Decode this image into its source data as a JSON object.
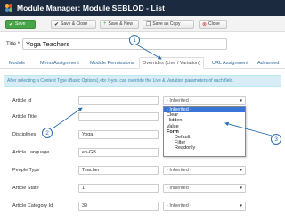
{
  "header": {
    "title": "Module Manager: Module SEBLOD - List"
  },
  "toolbar": {
    "save": "Save",
    "save_close": "Save & Close",
    "save_new": "Save & New",
    "save_copy": "Save as Copy",
    "close": "Close"
  },
  "title_field": {
    "label": "Title *",
    "value": "Yoga Teachers"
  },
  "tabs": [
    {
      "label": "Module"
    },
    {
      "label": "Menu Assignment"
    },
    {
      "label": "Module Permissions"
    },
    {
      "label": "Overrides (Live / Variation)"
    },
    {
      "label": "URL Assignment"
    },
    {
      "label": "Advanced"
    }
  ],
  "info_text": "After selecting a Content Type (Basic Options),<br />you can override the Live & Variation parameters of each field.",
  "fields": [
    {
      "label": "Article Id",
      "value": "",
      "select": "- Inherited -"
    },
    {
      "label": "Article Title",
      "value": "",
      "select": ""
    },
    {
      "label": "Disciplines",
      "value": "Yoga",
      "select": ""
    },
    {
      "label": "Article Language",
      "value": "en-GB",
      "select": ""
    },
    {
      "label": "People Type",
      "value": "Teacher",
      "select": "- Inherited -"
    },
    {
      "label": "Article State",
      "value": "1",
      "select": "- Inherited -"
    },
    {
      "label": "Article Category Id",
      "value": "39",
      "select": "- Inherited -"
    }
  ],
  "dropdown": {
    "options": [
      {
        "label": "- Inherited -",
        "type": "selected"
      },
      {
        "label": "Clear",
        "type": "option"
      },
      {
        "label": "Hidden",
        "type": "option"
      },
      {
        "label": "Value",
        "type": "option"
      },
      {
        "label": "Form",
        "type": "group"
      },
      {
        "label": "Default",
        "type": "sub"
      },
      {
        "label": "Filter",
        "type": "sub"
      },
      {
        "label": "Readonly",
        "type": "sub"
      }
    ]
  },
  "callouts": [
    "1",
    "2",
    "3"
  ],
  "colors": {
    "header_bg": "#1b2a3f",
    "save_green": "#47a447",
    "info_bg": "#d9edf7",
    "callout_blue": "#2a6cb0",
    "select_highlight": "#3875d7"
  }
}
